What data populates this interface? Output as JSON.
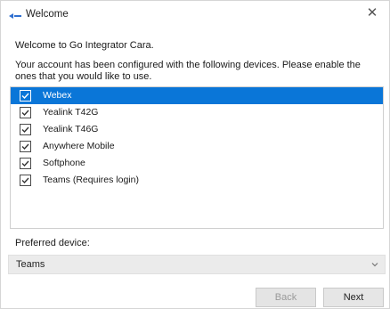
{
  "window": {
    "title": "Welcome"
  },
  "welcome_text": "Welcome to Go Integrator Cara.",
  "description": "Your account has been configured with the following devices. Please enable the ones that you would like to use.",
  "devices": [
    {
      "label": "Webex",
      "checked": true,
      "selected": true
    },
    {
      "label": "Yealink T42G",
      "checked": true,
      "selected": false
    },
    {
      "label": "Yealink T46G",
      "checked": true,
      "selected": false
    },
    {
      "label": "Anywhere Mobile",
      "checked": true,
      "selected": false
    },
    {
      "label": "Softphone",
      "checked": true,
      "selected": false
    },
    {
      "label": "Teams (Requires login)",
      "checked": true,
      "selected": false
    }
  ],
  "preferred": {
    "label": "Preferred device:",
    "value": "Teams"
  },
  "buttons": {
    "back": "Back",
    "next": "Next"
  },
  "colors": {
    "selection": "#0a76d8",
    "app_icon": "#2f6fd0"
  }
}
